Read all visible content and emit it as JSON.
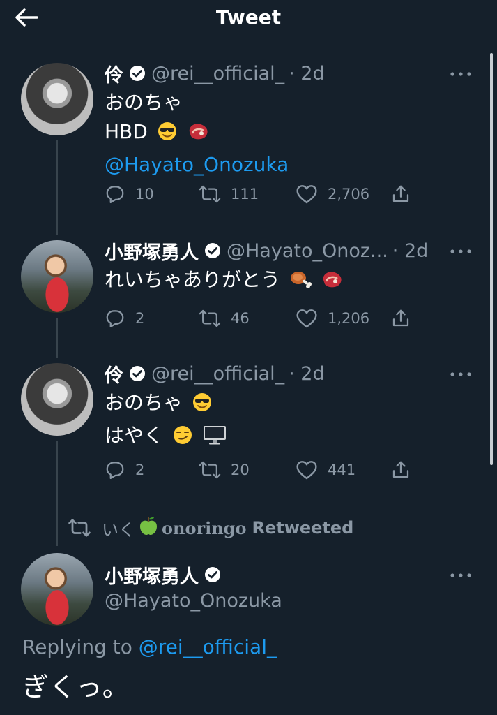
{
  "header": {
    "title": "Tweet"
  },
  "tweets": [
    {
      "name": "伶",
      "handle": "@rei__official_",
      "time": "· 2d",
      "lines": [
        "おのちゃ",
        "HBD",
        "@Hayato_Onozuka"
      ],
      "replies": "10",
      "retweets": "111",
      "likes": "2,706"
    },
    {
      "name": "小野塚勇人",
      "handle": "@Hayato_Onoz...",
      "time": "· 2d",
      "lines": [
        "れいちゃありがとう"
      ],
      "replies": "2",
      "retweets": "46",
      "likes": "1,206"
    },
    {
      "name": "伶",
      "handle": "@rei__official_",
      "time": "· 2d",
      "lines": [
        "おのちゃ",
        "はやく"
      ],
      "replies": "2",
      "retweets": "20",
      "likes": "441"
    }
  ],
  "retweet_banner": {
    "prefix": "いく",
    "name": "onoringo",
    "label": "Retweeted"
  },
  "focus_tweet": {
    "name": "小野塚勇人",
    "handle": "@Hayato_Onozuka",
    "replying_prefix": "Replying to",
    "replying_to": "@rei__official_",
    "text": "ぎくっ。"
  },
  "colors": {
    "background": "#15202b",
    "text": "#ffffff",
    "secondary": "#8b98a5",
    "accent": "#1d9bf0",
    "thread_line": "#38444d"
  }
}
